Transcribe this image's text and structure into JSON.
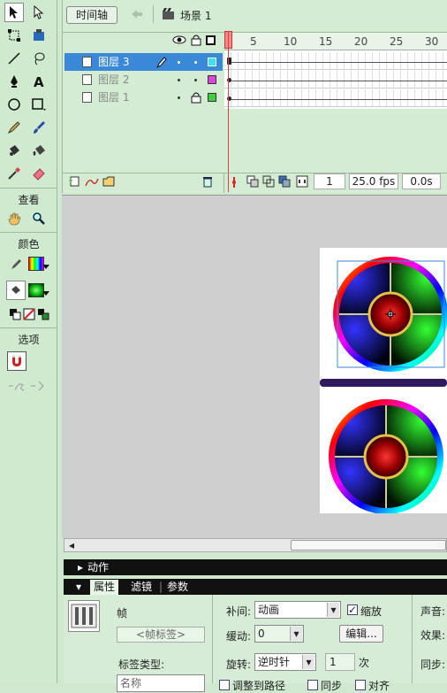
{
  "tools": {
    "view_label": "查看",
    "color_label": "颜色",
    "options_label": "选项"
  },
  "timeline": {
    "tab_label": "时间轴",
    "scene_label": "场景 1",
    "ruler": [
      "1",
      "5",
      "10",
      "15",
      "20",
      "25",
      "30"
    ],
    "layers": [
      {
        "name": "图层 3",
        "color": "#44ddee"
      },
      {
        "name": "图层 2",
        "color": "#dd44dd"
      },
      {
        "name": "图层 1",
        "color": "#44cc44"
      }
    ],
    "frame": "1",
    "fps": "25.0 fps",
    "time": "0.0s"
  },
  "panels": {
    "actions_label": "动作",
    "properties_tab": "属性",
    "filters_tab": "滤镜",
    "params_tab": "参数"
  },
  "props": {
    "frame_label": "帧",
    "frame_label_placeholder": "<帧标签>",
    "label_type": "标签类型:",
    "label_type_value": "名称",
    "tween_label": "补间:",
    "tween_value": "动画",
    "scale_label": "缩放",
    "ease_label": "缓动:",
    "ease_value": "0",
    "edit_button": "编辑...",
    "rotate_label": "旋转:",
    "rotate_value": "逆时针",
    "rotate_count": "1",
    "times_label": "次",
    "sound_label": "声音:",
    "effect_label": "效果:",
    "sync_label": "同步:",
    "orient_label": "调整到路径",
    "snap_label": "同步",
    "align_label": "对齐"
  },
  "colors": {
    "accent": "#3a88d8",
    "path": "#2e1a5c"
  }
}
